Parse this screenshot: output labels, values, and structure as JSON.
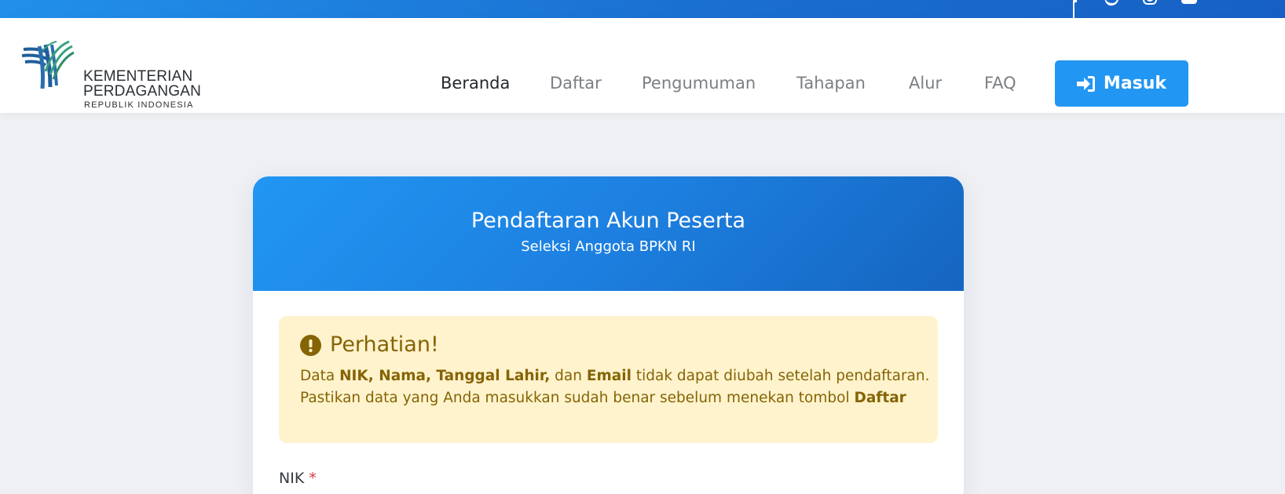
{
  "topbar": {
    "social": [
      "facebook-icon",
      "twitter-icon",
      "instagram-icon",
      "youtube-icon"
    ]
  },
  "logo": {
    "line1": "KEMENTERIAN",
    "line2": "PERDAGANGAN",
    "line3": "REPUBLIK INDONESIA"
  },
  "nav": {
    "items": [
      {
        "label": "Beranda",
        "active": true
      },
      {
        "label": "Daftar"
      },
      {
        "label": "Pengumuman"
      },
      {
        "label": "Tahapan"
      },
      {
        "label": "Alur"
      },
      {
        "label": "FAQ"
      }
    ],
    "login_label": "Masuk",
    "login_icon": "sign-in-icon"
  },
  "card": {
    "title": "Pendaftaran Akun Peserta",
    "subtitle": "Seleksi Anggota BPKN RI"
  },
  "alert": {
    "icon": "exclamation-circle-icon",
    "title": "Perhatian!",
    "line1": {
      "prefix": "Data ",
      "bold1": "NIK, Nama, Tanggal Lahir,",
      "mid": " dan ",
      "bold2": "Email",
      "suffix": " tidak dapat diubah setelah pendaftaran."
    },
    "line2": {
      "text": "Pastikan data yang Anda masukkan sudah benar sebelum menekan tombol ",
      "bold": "Daftar"
    }
  },
  "form": {
    "nik_label": "NIK",
    "required_mark": "*"
  },
  "colors": {
    "primary": "#2196f3",
    "primary_dark": "#1565c0",
    "alert_bg": "#fff3cd",
    "alert_text": "#856404",
    "required": "#dc3545"
  }
}
